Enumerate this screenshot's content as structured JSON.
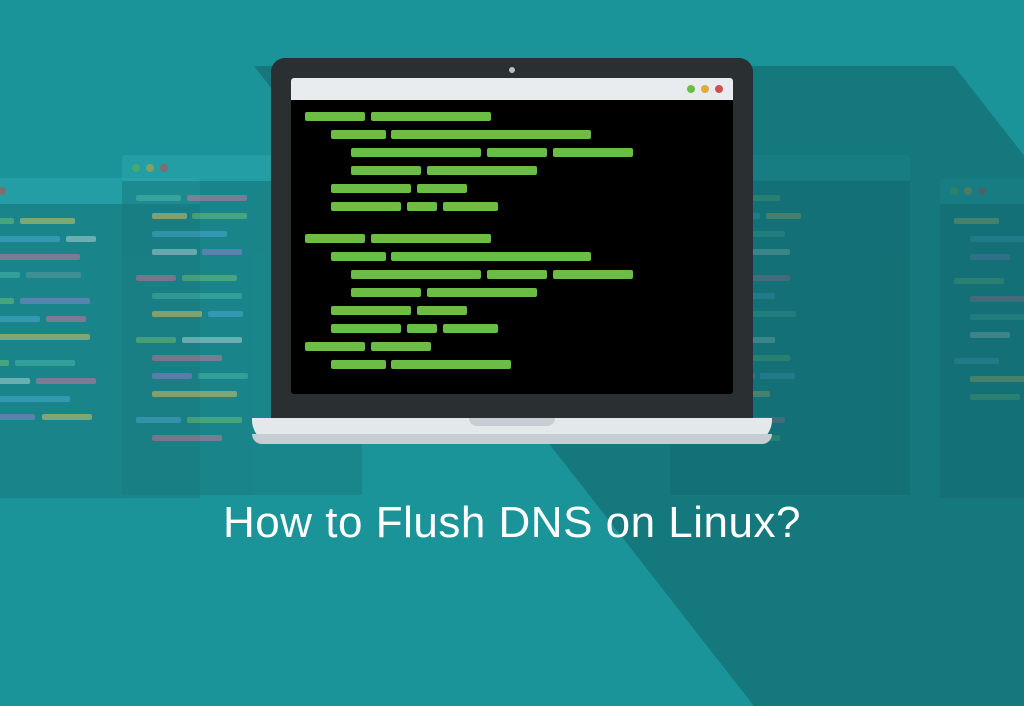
{
  "headline": "How to Flush DNS on Linux?",
  "colors": {
    "background": "#1a9499",
    "code_green": "#6cbd45",
    "laptop_frame": "#2a2f32",
    "terminal_bg": "#000000",
    "titlebar_dot_green": "#6cbd45",
    "titlebar_dot_yellow": "#e2a83a",
    "titlebar_dot_red": "#d05050"
  },
  "icon_names": {
    "window_control_close": "close-icon",
    "window_control_min": "minimize-icon",
    "window_control_max": "maximize-icon",
    "camera": "webcam-icon"
  }
}
